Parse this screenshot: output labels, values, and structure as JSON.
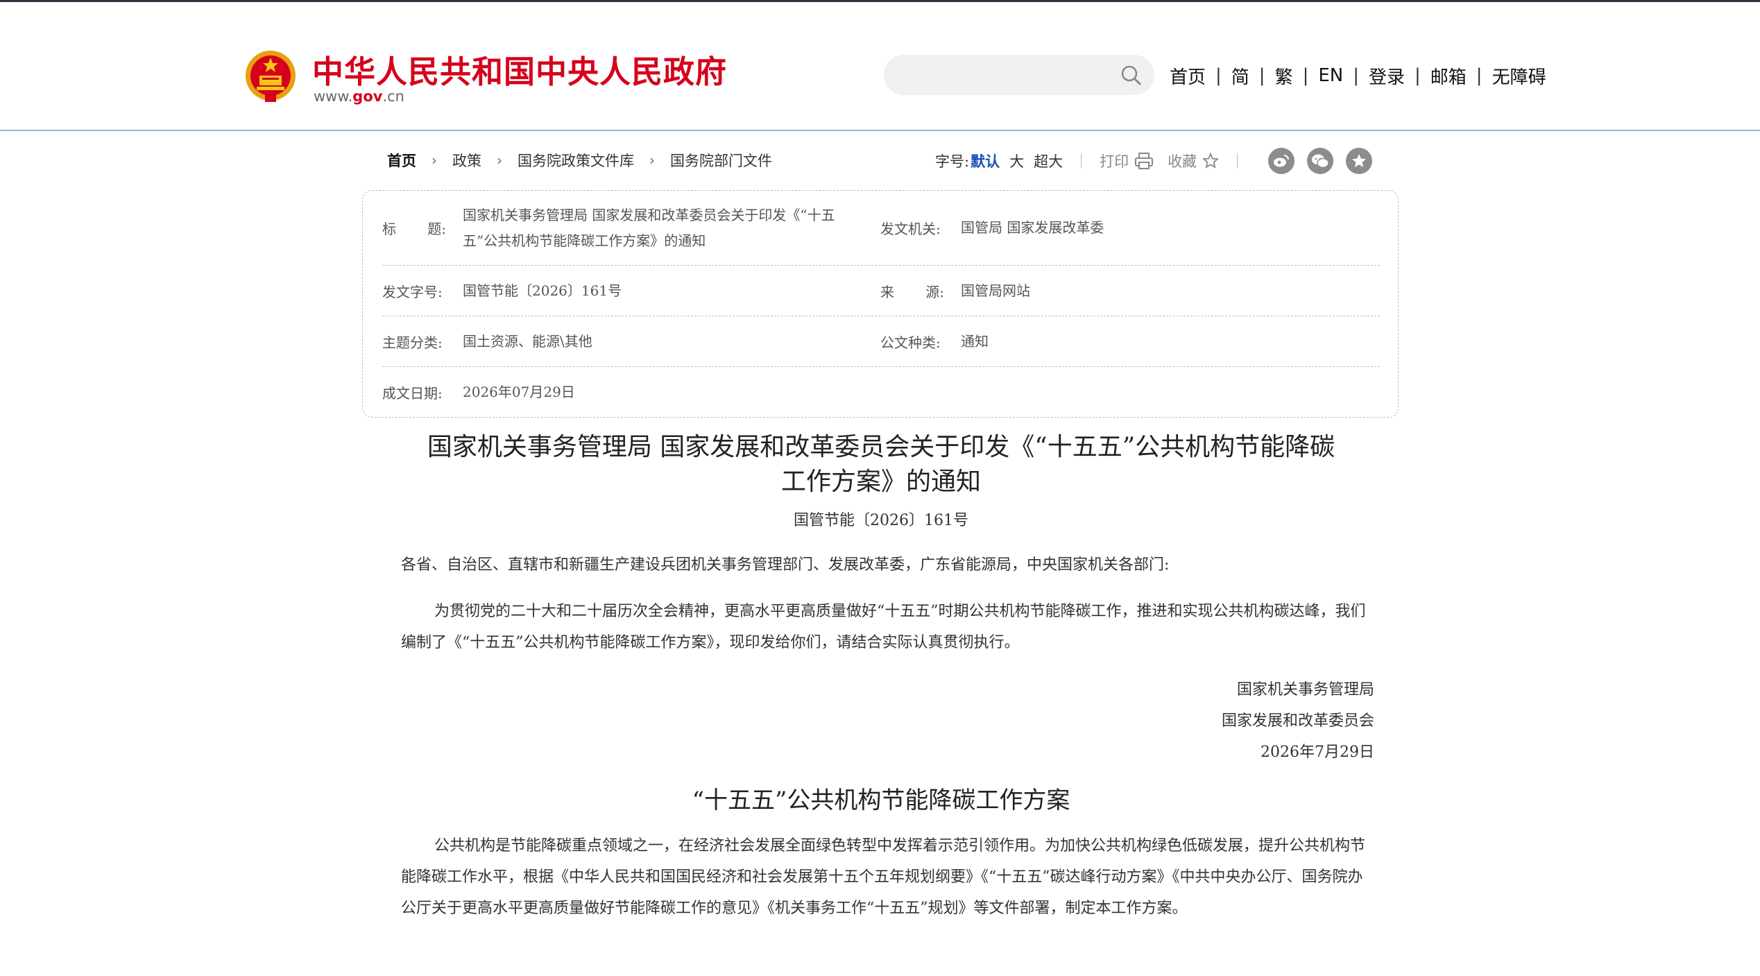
{
  "header": {
    "site_title": "中华人民共和国中央人民政府",
    "site_url_pre": "www.",
    "site_url_mid": "gov",
    "site_url_post": ".cn",
    "search_placeholder": "",
    "nav": [
      "首页",
      "简",
      "繁",
      "EN",
      "登录",
      "邮箱",
      "无障碍"
    ],
    "separator": "|"
  },
  "breadcrumb": [
    "首页",
    "政策",
    "国务院政策文件库",
    "国务院部门文件"
  ],
  "tools": {
    "font_size_label": "字号:",
    "font_sizes": [
      "默认",
      "大",
      "超大"
    ],
    "print_label": "打印",
    "favorite_label": "收藏"
  },
  "info": {
    "title_label_a": "标",
    "title_label_b": "题:",
    "title_value": "国家机关事务管理局 国家发展和改革委员会关于印发《“十五五”公共机构节能降碳工作方案》的通知",
    "title_value_line1": "国家机关事务管理局 国家发展和改革委员会关于印发《“十五",
    "title_value_line2": "五”公共机构节能降碳工作方案》的通知",
    "issuer_label": "发文机关:",
    "issuer_value": "国管局 国家发展改革委",
    "docno_label": "发文字号:",
    "docno_value": "国管节能〔2026〕161号",
    "source_label_a": "来",
    "source_label_b": "源:",
    "source_value": "国管局网站",
    "topic_label": "主题分类:",
    "topic_value": "国土资源、能源\\其他",
    "type_label": "公文种类:",
    "type_value": "通知",
    "date_label": "成文日期:",
    "date_value": "2026年07月29日"
  },
  "article": {
    "title_line1": "国家机关事务管理局 国家发展和改革委员会关于印发《“十五五”公共机构节能降碳",
    "title_line2": "工作方案》的通知",
    "doc_number": "国管节能〔2026〕161号",
    "salutation": "各省、自治区、直辖市和新疆生产建设兵团机关事务管理部门、发展改革委，广东省能源局，中央国家机关各部门:",
    "para1": "为贯彻党的二十大和二十届历次全会精神，更高水平更高质量做好“十五五”时期公共机构节能降碳工作，推进和实现公共机构碳达峰，我们编制了《“十五五”公共机构节能降碳工作方案》，现印发给你们，请结合实际认真贯彻执行。",
    "sign1": "国家机关事务管理局",
    "sign2": "国家发展和改革委员会",
    "sign_date": "2026年7月29日",
    "subtitle": "“十五五”公共机构节能降碳工作方案",
    "para2": "公共机构是节能降碳重点领域之一，在经济社会发展全面绿色转型中发挥着示范引领作用。为加快公共机构绿色低碳发展，提升公共机构节能降碳工作水平，根据《中华人民共和国国民经济和社会发展第十五个五年规划纲要》《“十五五”碳达峰行动方案》《中共中央办公厅、国务院办公厅关于更高水平更高质量做好节能降碳工作的意见》《机关事务工作“十五五”规划》等文件部署，制定本工作方案。"
  },
  "colors": {
    "brand_red": "#d6001c",
    "link_blue": "#1b4fb8",
    "header_border": "#9bb1d4"
  },
  "icons": [
    "national-emblem-icon",
    "search-icon",
    "print-icon",
    "star-icon",
    "weibo-icon",
    "wechat-icon",
    "qzone-icon"
  ]
}
